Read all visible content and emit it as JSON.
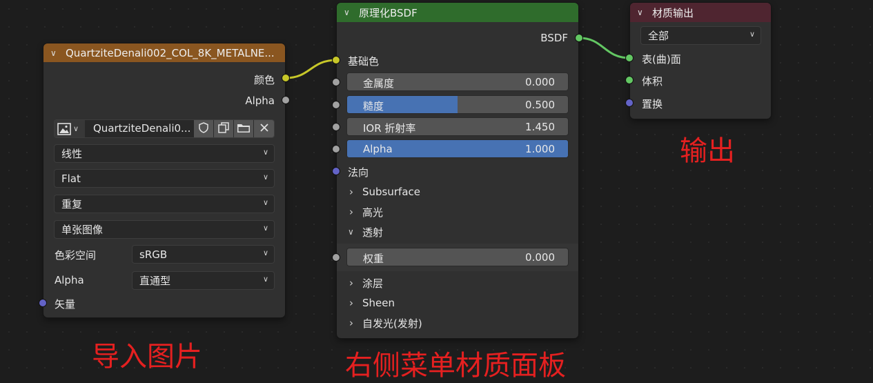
{
  "image_node": {
    "title": "QuartziteDenali002_COL_8K_METALNE...",
    "header_color": "#8a5620",
    "outputs": [
      {
        "label": "颜色",
        "socket": "yellow"
      },
      {
        "label": "Alpha",
        "socket": "gray"
      }
    ],
    "image_name": "QuartziteDenali0...",
    "icons": [
      "image-icon",
      "shield-icon",
      "duplicate-icon",
      "folder-icon",
      "close-icon"
    ],
    "interpolation": "线性",
    "projection": "Flat",
    "extension": "重复",
    "source": "单张图像",
    "color_space_label": "色彩空间",
    "color_space": "sRGB",
    "alpha_label": "Alpha",
    "alpha_mode": "直通型",
    "vector_label": "矢量"
  },
  "bsdf_node": {
    "title": "原理化BSDF",
    "header_color": "#2f6c2c",
    "output_label": "BSDF",
    "base_color_label": "基础色",
    "fields": [
      {
        "label": "金属度",
        "value": "0.000",
        "fill": 0.0
      },
      {
        "label": "糙度",
        "value": "0.500",
        "fill": 0.5
      },
      {
        "label": "IOR 折射率",
        "value": "1.450",
        "fill": 0.0
      },
      {
        "label": "Alpha",
        "value": "1.000",
        "fill": 1.0
      }
    ],
    "normal_label": "法向",
    "panels": [
      {
        "label": "Subsurface",
        "expanded": false
      },
      {
        "label": "高光",
        "expanded": false
      },
      {
        "label": "透射",
        "expanded": true
      }
    ],
    "weight_field": {
      "label": "权重",
      "value": "0.000",
      "fill": 0.0
    },
    "panels_after": [
      {
        "label": "涂层",
        "expanded": false
      },
      {
        "label": "Sheen",
        "expanded": false
      },
      {
        "label": "自发光(发射)",
        "expanded": false
      }
    ]
  },
  "output_node": {
    "title": "材质输出",
    "header_color": "#4f2530",
    "target": "全部",
    "inputs": [
      {
        "label": "表(曲)面",
        "socket": "green"
      },
      {
        "label": "体积",
        "socket": "green"
      },
      {
        "label": "置换",
        "socket": "purple"
      }
    ]
  },
  "annotations": {
    "import": "导入图片",
    "panel": "右侧菜单材质面板",
    "output": "输出"
  },
  "colors": {
    "link_yellow": "#c7c729",
    "link_green": "#63c763",
    "annotation_red": "#e52020",
    "field_fill": "#4772b3"
  }
}
